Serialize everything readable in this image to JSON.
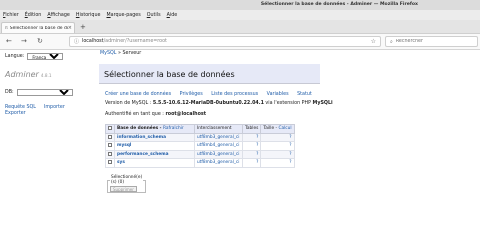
{
  "window": {
    "title": "Sélectionner la base de données - Adminer — Mozilla Firefox"
  },
  "menu": [
    {
      "underline": "F",
      "rest": "ichier"
    },
    {
      "underline": "É",
      "rest": "dition"
    },
    {
      "underline": "A",
      "rest": "ffichage"
    },
    {
      "underline": "H",
      "rest": "istorique"
    },
    {
      "underline": "M",
      "rest": "arque-pages"
    },
    {
      "underline": "O",
      "rest": "utils"
    },
    {
      "underline": "A",
      "rest": "ide"
    }
  ],
  "tab": {
    "label": "Sélectionner la base de données",
    "favicon": "π"
  },
  "nav": {
    "host": "localhost",
    "path": "/adminer/?username=root",
    "search_placeholder": "Rechercher"
  },
  "page": {
    "language_label": "Langue:",
    "language_value": "Français",
    "breadcrumb_mysql": "MySQL",
    "breadcrumb_sep": " » ",
    "breadcrumb_server": "Serveur",
    "logo": "Adminer",
    "version": "4.8.1",
    "heading": "Sélectionner la base de données",
    "db_label": "DB:",
    "sql_request": "Requête SQL",
    "import": "Importer",
    "export": "Exporter",
    "actions": [
      "Créer une base de données",
      "Privilèges",
      "Liste des processus",
      "Variables",
      "Statut"
    ],
    "version_prefix": "Version de MySQL : ",
    "mysql_version": "5.5.5-10.6.12-MariaDB-0ubuntu0.22.04.1",
    "version_mid": " via l'extension PHP ",
    "php_ext": "MySQLi",
    "auth_prefix": "Authentifié en tant que : ",
    "auth_user": "root@localhost",
    "table": {
      "col_db": "Base de données",
      "col_refresh": "Rafraîchir",
      "col_collation": "Interclassement",
      "col_tables": "Tables",
      "col_size": "Taille",
      "col_calc": "Calcul",
      "rows": [
        {
          "name": "information_schema",
          "collation": "utf8mb3_general_ci",
          "tables": "?",
          "size": "?"
        },
        {
          "name": "mysql",
          "collation": "utf8mb4_general_ci",
          "tables": "?",
          "size": "?"
        },
        {
          "name": "performance_schema",
          "collation": "utf8mb3_general_ci",
          "tables": "?",
          "size": "?"
        },
        {
          "name": "sys",
          "collation": "utf8mb3_general_ci",
          "tables": "?",
          "size": "?"
        }
      ]
    },
    "selected_legend": "Sélectionné(e)(s) (0)",
    "delete_button": "Supprimer"
  }
}
